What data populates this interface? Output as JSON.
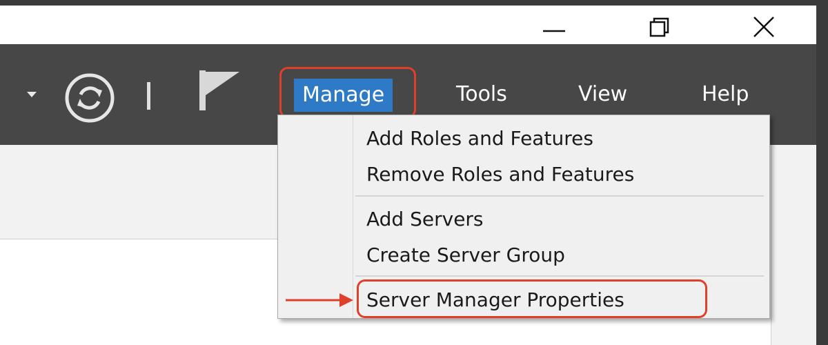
{
  "toolbar": {
    "menus": [
      {
        "label": "Manage"
      },
      {
        "label": "Tools"
      },
      {
        "label": "View"
      },
      {
        "label": "Help"
      }
    ],
    "icons": [
      "dropdown-caret-icon",
      "refresh-icon",
      "notifications-flag-icon"
    ]
  },
  "manage_menu": {
    "items": [
      {
        "label": "Add Roles and Features"
      },
      {
        "label": "Remove Roles and Features"
      },
      {
        "label": "Add Servers"
      },
      {
        "label": "Create Server Group"
      },
      {
        "label": "Server Manager Properties"
      }
    ]
  },
  "window_controls": [
    "minimize-icon",
    "restore-icon",
    "close-icon"
  ],
  "colors": {
    "toolbar_bg": "#474747",
    "active_menu_bg": "#2f7ac7",
    "annotation_red": "#e0402a"
  }
}
